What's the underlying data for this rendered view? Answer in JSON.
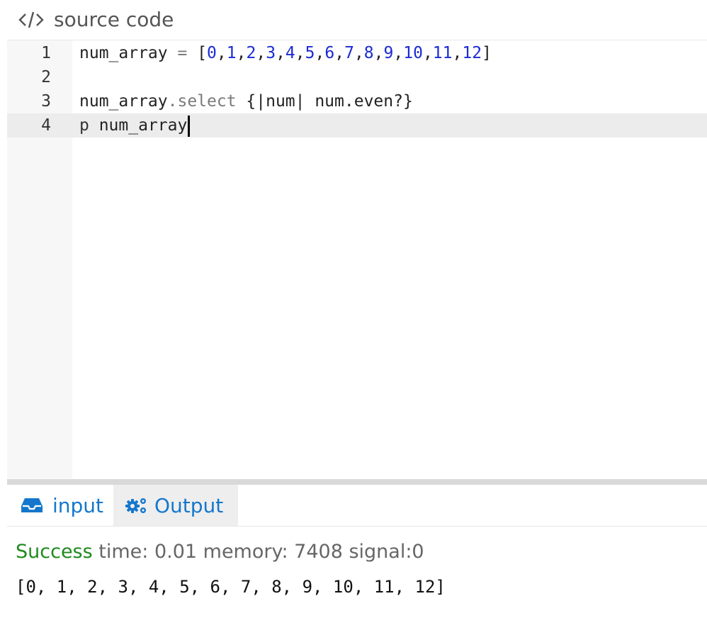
{
  "header": {
    "title": "source code",
    "icon": "code-icon"
  },
  "editor": {
    "lines": [
      {
        "number": "1",
        "tokens": [
          {
            "t": "num_array ",
            "k": "id"
          },
          {
            "t": "=",
            "k": "op"
          },
          {
            "t": " [",
            "k": "id"
          },
          {
            "t": "0",
            "k": "num"
          },
          {
            "t": ",",
            "k": "id"
          },
          {
            "t": "1",
            "k": "num"
          },
          {
            "t": ",",
            "k": "id"
          },
          {
            "t": "2",
            "k": "num"
          },
          {
            "t": ",",
            "k": "id"
          },
          {
            "t": "3",
            "k": "num"
          },
          {
            "t": ",",
            "k": "id"
          },
          {
            "t": "4",
            "k": "num"
          },
          {
            "t": ",",
            "k": "id"
          },
          {
            "t": "5",
            "k": "num"
          },
          {
            "t": ",",
            "k": "id"
          },
          {
            "t": "6",
            "k": "num"
          },
          {
            "t": ",",
            "k": "id"
          },
          {
            "t": "7",
            "k": "num"
          },
          {
            "t": ",",
            "k": "id"
          },
          {
            "t": "8",
            "k": "num"
          },
          {
            "t": ",",
            "k": "id"
          },
          {
            "t": "9",
            "k": "num"
          },
          {
            "t": ",",
            "k": "id"
          },
          {
            "t": "10",
            "k": "num"
          },
          {
            "t": ",",
            "k": "id"
          },
          {
            "t": "11",
            "k": "num"
          },
          {
            "t": ",",
            "k": "id"
          },
          {
            "t": "12",
            "k": "num"
          },
          {
            "t": "]",
            "k": "id"
          }
        ]
      },
      {
        "number": "2",
        "tokens": []
      },
      {
        "number": "3",
        "tokens": [
          {
            "t": "num_array",
            "k": "id"
          },
          {
            "t": ".select",
            "k": "meth"
          },
          {
            "t": " {|num| num.even?}",
            "k": "id"
          }
        ]
      },
      {
        "number": "4",
        "tokens": [
          {
            "t": "p",
            "k": "kw"
          },
          {
            "t": " num_array",
            "k": "id"
          }
        ],
        "active": true,
        "cursor": true
      }
    ]
  },
  "tabs": [
    {
      "label": "input",
      "icon": "inbox-icon"
    },
    {
      "label": "Output",
      "icon": "gears-icon",
      "active": true
    }
  ],
  "result": {
    "status": "Success",
    "details": " time: 0.01 memory: 7408 signal:0",
    "stdout": "[0, 1, 2, 3, 4, 5, 6, 7, 8, 9, 10, 11, 12]"
  },
  "colors": {
    "accent": "#1577cc",
    "success": "#1e8a1e",
    "number": "#1a2bd4"
  }
}
